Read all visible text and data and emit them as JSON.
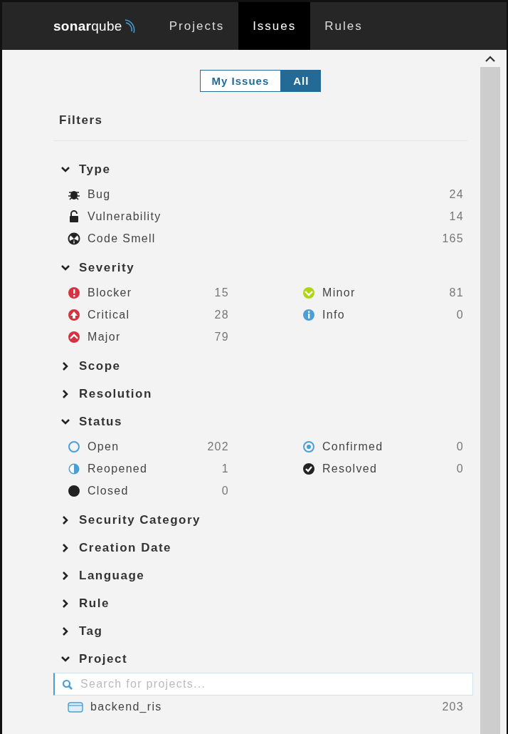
{
  "navbar": {
    "logo": "**sonar**qube",
    "tabs": [
      {
        "label": "Projects",
        "selected": false
      },
      {
        "label": "Issues",
        "selected": true
      },
      {
        "label": "Rules",
        "selected": false
      }
    ]
  },
  "scope_toggle": [
    {
      "label": "My Issues",
      "selected": false
    },
    {
      "label": "All",
      "selected": true
    }
  ],
  "filters_title": "Filters",
  "facets": [
    {
      "title": "Type",
      "expanded": true,
      "kind": "list",
      "items": [
        {
          "kind": "bug",
          "label": "Bug",
          "count": "24"
        },
        {
          "kind": "vulnerability",
          "label": "Vulnerability",
          "count": "14"
        },
        {
          "kind": "code-smell",
          "label": "Code Smell",
          "count": "165"
        }
      ]
    },
    {
      "title": "Severity",
      "expanded": true,
      "kind": "grid",
      "items": [
        {
          "kind": "blocker",
          "label": "Blocker",
          "count": "15"
        },
        {
          "kind": "minor",
          "label": "Minor",
          "count": "81"
        },
        {
          "kind": "critical",
          "label": "Critical",
          "count": "28"
        },
        {
          "kind": "info",
          "label": "Info",
          "count": "0"
        },
        {
          "kind": "major",
          "label": "Major",
          "count": "79"
        }
      ]
    },
    {
      "title": "Scope",
      "expanded": false
    },
    {
      "title": "Resolution",
      "expanded": false
    },
    {
      "title": "Status",
      "expanded": true,
      "kind": "grid",
      "items": [
        {
          "kind": "open",
          "label": "Open",
          "count": "202"
        },
        {
          "kind": "confirmed",
          "label": "Confirmed",
          "count": "0"
        },
        {
          "kind": "reopened",
          "label": "Reopened",
          "count": "1"
        },
        {
          "kind": "resolved",
          "label": "Resolved",
          "count": "0"
        },
        {
          "kind": "closed",
          "label": "Closed",
          "count": "0"
        }
      ]
    },
    {
      "title": "Security Category",
      "expanded": false
    },
    {
      "title": "Creation Date",
      "expanded": false
    },
    {
      "title": "Language",
      "expanded": false
    },
    {
      "title": "Rule",
      "expanded": false
    },
    {
      "title": "Tag",
      "expanded": false
    },
    {
      "title": "Project",
      "expanded": true,
      "kind": "list",
      "search": {
        "placeholder": "Search for projects..."
      },
      "items": [
        {
          "kind": "project",
          "label": "backend_ris",
          "count": "203"
        }
      ]
    }
  ]
}
